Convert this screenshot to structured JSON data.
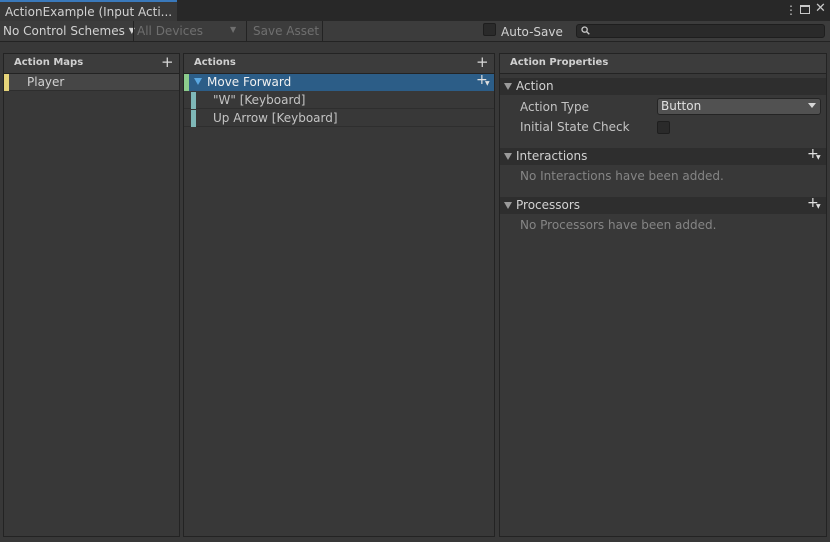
{
  "window": {
    "tab_title": "ActionExample (Input Acti...",
    "menu_icon": "kebab-menu-icon",
    "maximize_icon": "maximize-icon",
    "close_icon": "close-icon"
  },
  "toolbar": {
    "control_schemes": "No Control Schemes",
    "devices": "All Devices",
    "save_asset": "Save Asset",
    "auto_save_label": "Auto-Save",
    "auto_save_checked": false,
    "search_placeholder": ""
  },
  "action_maps": {
    "header": "Action Maps",
    "items": [
      {
        "label": "Player",
        "color": "#e6d47a"
      }
    ]
  },
  "actions": {
    "header": "Actions",
    "selected": {
      "label": "Move Forward",
      "color": "#8ccc8c"
    },
    "bindings": [
      {
        "label": "\"W\" [Keyboard]",
        "color": "#7fb8b8"
      },
      {
        "label": "Up Arrow [Keyboard]",
        "color": "#7fb8b8"
      }
    ]
  },
  "properties": {
    "header": "Action Properties",
    "action_section": "Action",
    "action_type_label": "Action Type",
    "action_type_value": "Button",
    "initial_state_label": "Initial State Check",
    "initial_state_checked": false,
    "interactions_section": "Interactions",
    "interactions_empty": "No Interactions have been added.",
    "processors_section": "Processors",
    "processors_empty": "No Processors have been added."
  },
  "colors": {
    "accent": "#3a79bb",
    "selection": "#2c5d87"
  }
}
